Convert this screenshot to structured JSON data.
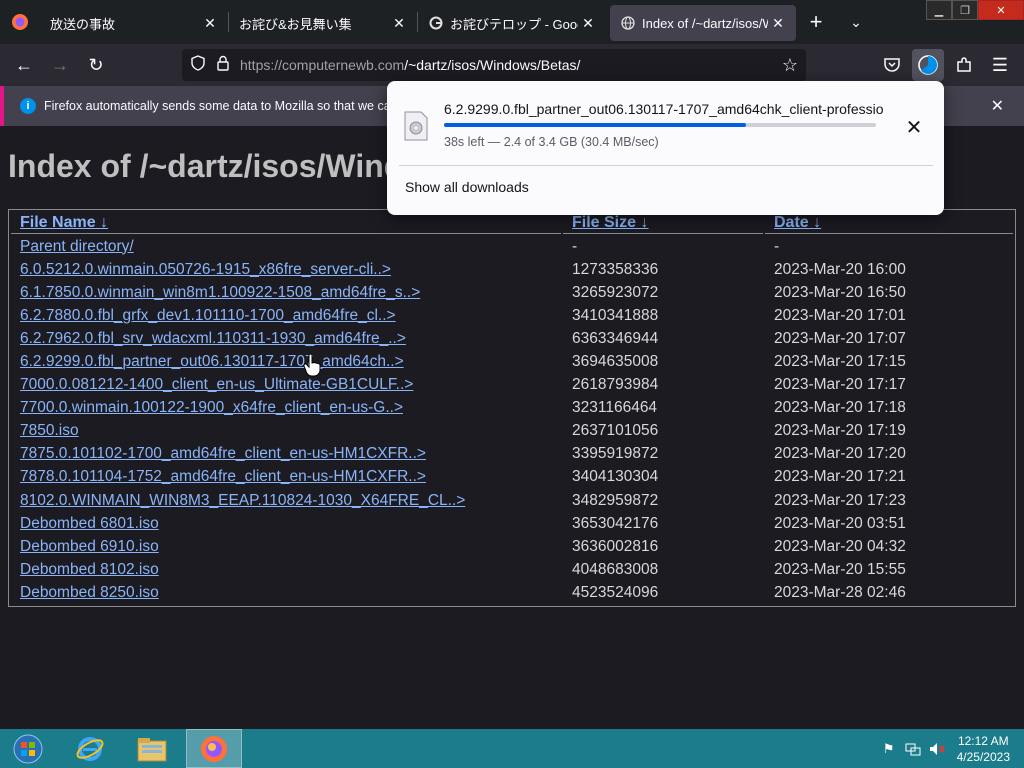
{
  "tabs": [
    {
      "title": "放送の事故",
      "active": false,
      "icon": "firefox-icon"
    },
    {
      "title": "お詫び&お見舞い集",
      "active": false,
      "icon": "none"
    },
    {
      "title": "お詫びテロップ - Google",
      "active": false,
      "icon": "google-icon"
    },
    {
      "title": "Index of /~dartz/isos/Wi",
      "active": true,
      "icon": "globe-icon"
    }
  ],
  "navbar": {
    "url_host": "https://computernewb.com",
    "url_path": "/~dartz/isos/Windows/Betas/"
  },
  "notification": {
    "message": "Firefox automatically sends some data to Mozilla so that we can i"
  },
  "page": {
    "heading": "Index of /~dartz/isos/Wind",
    "columns": {
      "name": "File Name",
      "size": "File Size",
      "date": "Date",
      "sort_arrow": "↓"
    },
    "parent": {
      "name": "Parent directory/",
      "size": "-",
      "date": "-"
    },
    "rows": [
      {
        "name": "6.0.5212.0.winmain.050726-1915_x86fre_server-cli..>",
        "size": "1273358336",
        "date": "2023-Mar-20 16:00"
      },
      {
        "name": "6.1.7850.0.winmain_win8m1.100922-1508_amd64fre_s..>",
        "size": "3265923072",
        "date": "2023-Mar-20 16:50"
      },
      {
        "name": "6.2.7880.0.fbl_grfx_dev1.101110-1700_amd64fre_cl..>",
        "size": "3410341888",
        "date": "2023-Mar-20 17:01"
      },
      {
        "name": "6.2.7962.0.fbl_srv_wdacxml.110311-1930_amd64fre_..>",
        "size": "6363346944",
        "date": "2023-Mar-20 17:07"
      },
      {
        "name": "6.2.9299.0.fbl_partner_out06.130117-1707_amd64ch..>",
        "size": "3694635008",
        "date": "2023-Mar-20 17:15"
      },
      {
        "name": "7000.0.081212-1400_client_en-us_Ultimate-GB1CULF..>",
        "size": "2618793984",
        "date": "2023-Mar-20 17:17"
      },
      {
        "name": "7700.0.winmain.100122-1900_x64fre_client_en-us-G..>",
        "size": "3231166464",
        "date": "2023-Mar-20 17:18"
      },
      {
        "name": "7850.iso",
        "size": "2637101056",
        "date": "2023-Mar-20 17:19"
      },
      {
        "name": "7875.0.101102-1700_amd64fre_client_en-us-HM1CXFR..>",
        "size": "3395919872",
        "date": "2023-Mar-20 17:20"
      },
      {
        "name": "7878.0.101104-1752_amd64fre_client_en-us-HM1CXFR..>",
        "size": "3404130304",
        "date": "2023-Mar-20 17:21"
      },
      {
        "name": "8102.0.WINMAIN_WIN8M3_EEAP.110824-1030_X64FRE_CL..>",
        "size": "3482959872",
        "date": "2023-Mar-20 17:23"
      },
      {
        "name": "Debombed 6801.iso",
        "size": "3653042176",
        "date": "2023-Mar-20 03:51"
      },
      {
        "name": "Debombed 6910.iso",
        "size": "3636002816",
        "date": "2023-Mar-20 04:32"
      },
      {
        "name": "Debombed 8102.iso",
        "size": "4048683008",
        "date": "2023-Mar-20 15:55"
      },
      {
        "name": "Debombed 8250.iso",
        "size": "4523524096",
        "date": "2023-Mar-28 02:46"
      }
    ]
  },
  "downloads": {
    "filename": "6.2.9299.0.fbl_partner_out06.130117-1707_amd64chk_client-professio",
    "status": "38s left — 2.4 of 3.4 GB (30.4 MB/sec)",
    "progress": 0.7,
    "show_all_label": "Show all downloads"
  },
  "taskbar": {
    "time": "12:12 AM",
    "date": "4/25/2023"
  },
  "colors": {
    "page_bg": "#1c1b22",
    "link": "#8ab4f8",
    "taskbar": "#1b7c8c",
    "progress": "#0061e0"
  }
}
